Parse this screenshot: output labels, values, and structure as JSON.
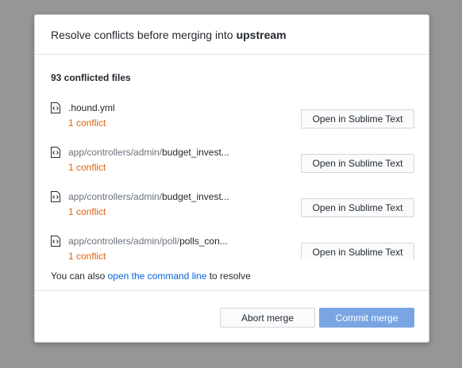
{
  "dialog": {
    "title_prefix": "Resolve conflicts before merging into",
    "branch": "upstream",
    "count_label": "93 conflicted files",
    "files": [
      {
        "dir": "",
        "name": ".hound.yml",
        "status": "1 conflict",
        "action": "Open in Sublime Text"
      },
      {
        "dir": "app/controllers/admin/",
        "name": "budget_invest...",
        "status": "1 conflict",
        "action": "Open in Sublime Text"
      },
      {
        "dir": "app/controllers/admin/",
        "name": "budget_invest...",
        "status": "1 conflict",
        "action": "Open in Sublime Text"
      },
      {
        "dir": "app/controllers/admin/poll/",
        "name": "polls_con...",
        "status": "1 conflict",
        "action": "Open in Sublime Text"
      }
    ],
    "hint_prefix": "You can also",
    "hint_link": "open the command line",
    "hint_suffix": "to resolve",
    "abort_label": "Abort merge",
    "commit_label": "Commit merge"
  },
  "icons": {
    "file": "file-code-icon"
  },
  "colors": {
    "conflict": "#e36209",
    "link": "#0366d6",
    "primary_button": "#79a6e3",
    "overlay": "#969696"
  }
}
